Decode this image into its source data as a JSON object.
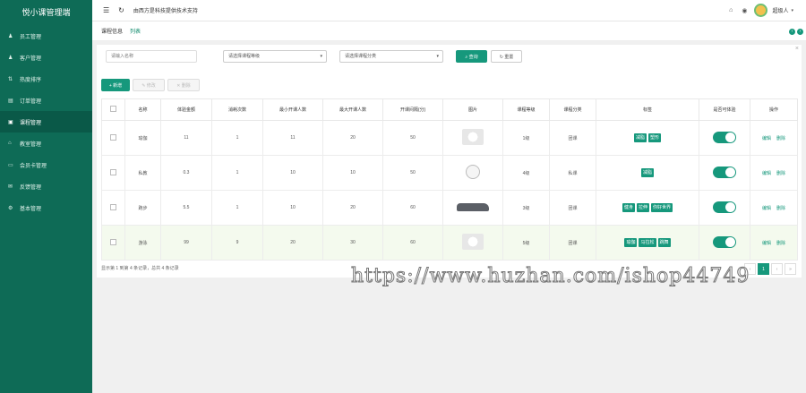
{
  "sidebar": {
    "brand": "悦小课管理端",
    "items": [
      {
        "label": "员工管理",
        "icon": "user-icon"
      },
      {
        "label": "客户管理",
        "icon": "users-icon"
      },
      {
        "label": "热度排序",
        "icon": "sort-icon"
      },
      {
        "label": "订单管理",
        "icon": "order-icon"
      },
      {
        "label": "课程管理",
        "icon": "book-icon",
        "active": true
      },
      {
        "label": "教室管理",
        "icon": "home-icon"
      },
      {
        "label": "会员卡管理",
        "icon": "card-icon"
      },
      {
        "label": "反馈管理",
        "icon": "feedback-icon"
      },
      {
        "label": "基本管理",
        "icon": "settings-icon"
      }
    ]
  },
  "topbar": {
    "notice": "由西方是科技提供技术支持",
    "user": "超级人"
  },
  "tabs": {
    "items": [
      "课程信息",
      "列表"
    ],
    "active_index": 1
  },
  "filters": {
    "keyword_placeholder": "请输入名称",
    "level_select": "请选择课程等级",
    "category_select": "请选择课程分类",
    "query_label": "查询",
    "reset_label": "重置"
  },
  "toolbar": {
    "add_label": "新增",
    "edit_label": "修改",
    "delete_label": "删除"
  },
  "table": {
    "columns": [
      "名称",
      "体验金额",
      "消耗次数",
      "最小开课人数",
      "最大开课人数",
      "开课间隔(分)",
      "图片",
      "课程等级",
      "课程分类",
      "标签",
      "是否可体验",
      "操作"
    ],
    "rows": [
      {
        "name": "瑜伽",
        "price": "11",
        "times": "1",
        "min": "11",
        "max": "20",
        "interval": "50",
        "pic": "panda",
        "level": "1级",
        "category": "团课",
        "tags": [
          "减脂",
          "塑形"
        ],
        "trial": true,
        "highlight": false
      },
      {
        "name": "私教",
        "price": "0.3",
        "times": "1",
        "min": "10",
        "max": "10",
        "interval": "50",
        "pic": "face",
        "level": "4级",
        "category": "私课",
        "tags": [
          "减脂"
        ],
        "trial": true,
        "highlight": false
      },
      {
        "name": "跑步",
        "price": "5.5",
        "times": "1",
        "min": "10",
        "max": "20",
        "interval": "60",
        "pic": "car",
        "level": "3级",
        "category": "团课",
        "tags": [
          "健身",
          "拉伸",
          "你好世界"
        ],
        "trial": true,
        "highlight": false
      },
      {
        "name": "游泳",
        "price": "99",
        "times": "9",
        "min": "20",
        "max": "30",
        "interval": "60",
        "pic": "panda",
        "level": "5级",
        "category": "团课",
        "tags": [
          "瑜伽",
          "马拉松",
          "跳舞"
        ],
        "trial": true,
        "highlight": true
      }
    ],
    "op_edit": "编辑",
    "op_delete": "删除"
  },
  "pager": {
    "summary": "显示第 1 到第 4 条记录，总共 4 条记录",
    "current": "1"
  },
  "watermark": "https://www.huzhan.com/ishop44749",
  "colors": {
    "sidebar": "#0e6b56",
    "accent": "#16987c"
  }
}
